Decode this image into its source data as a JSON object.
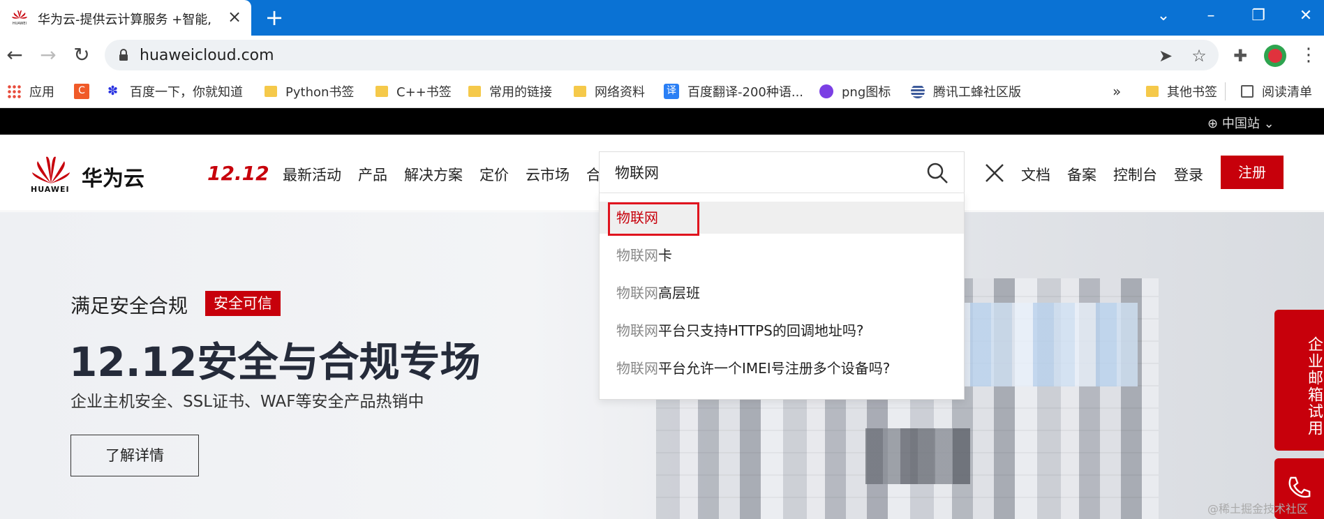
{
  "browser": {
    "tab_title": "华为云-提供云计算服务 +智能,",
    "url": "huaweicloud.com",
    "bookmarks": [
      {
        "label": "应用",
        "icon": "apps-grid-icon"
      },
      {
        "label": "",
        "icon": "c-site-icon"
      },
      {
        "label": "百度一下，你就知道",
        "icon": "baidu-paw-icon"
      },
      {
        "label": "Python书签",
        "icon": "folder-icon"
      },
      {
        "label": "C++书签",
        "icon": "folder-icon"
      },
      {
        "label": "常用的链接",
        "icon": "folder-icon"
      },
      {
        "label": "网络资料",
        "icon": "folder-icon"
      },
      {
        "label": "百度翻译-200种语...",
        "icon": "translate-icon"
      },
      {
        "label": "png图标",
        "icon": "png-icon"
      },
      {
        "label": "腾讯工蜂社区版",
        "icon": "tencent-icon"
      }
    ],
    "overflow": "»",
    "other_bookmarks": "其他书签",
    "reading_list": "阅读清单"
  },
  "site": {
    "region": "中国站",
    "logo_text": "华为云",
    "logo_sub": "HUAWEI",
    "promo": "12.12",
    "nav": [
      "最新活动",
      "产品",
      "解决方案",
      "定价",
      "云市场",
      "合"
    ],
    "right_nav": [
      "文档",
      "备案",
      "控制台",
      "登录"
    ],
    "signup": "注册",
    "search": {
      "value": "物联网",
      "suggestions": [
        {
          "hl": "物联网",
          "rest": ""
        },
        {
          "hl": "物联网",
          "rest": "卡"
        },
        {
          "hl": "物联网",
          "rest": "高层班"
        },
        {
          "hl": "物联网",
          "rest": "平台只支持HTTPS的回调地址吗?"
        },
        {
          "hl": "物联网",
          "rest": "平台允许一个IMEI号注册多个设备吗?"
        }
      ]
    },
    "hero": {
      "kicker": "满足安全合规",
      "tag": "安全可信",
      "title": "12.12安全与合规专场",
      "subtitle": "企业主机安全、SSL证书、WAF等安全产品热销中",
      "button": "了解详情"
    },
    "side_trial": "企业邮箱试用",
    "watermark": "@稀土掘金技术社区"
  },
  "colors": {
    "brand_red": "#c7000b",
    "tab_strip": "#0a72d4"
  }
}
